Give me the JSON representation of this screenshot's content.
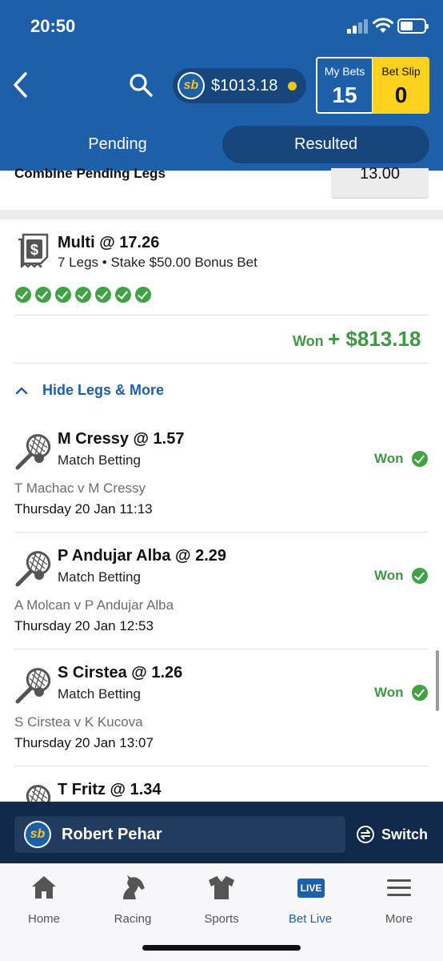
{
  "status_bar": {
    "time": "20:50",
    "battery_level": 0.55
  },
  "header": {
    "balance": "$1013.18",
    "my_bets": {
      "label": "My Bets",
      "count": "15"
    },
    "bet_slip": {
      "label": "Bet Slip",
      "count": "0"
    },
    "tabs": [
      {
        "label": "Pending",
        "active": false
      },
      {
        "label": "Resulted",
        "active": true
      }
    ],
    "colors": {
      "brand_blue": "#1d5fa8",
      "dark_blue": "#17467c",
      "yellow": "#fcd21f",
      "won_green": "#3a9a3f"
    }
  },
  "previous_bet": {
    "combine_label": "Combine Pending Legs",
    "combine_odds": "13.00"
  },
  "multi_bet": {
    "title": "Multi @ 17.26",
    "legs_count": "7 Legs",
    "stake": "Stake $50.00 Bonus Bet",
    "separator": "•",
    "legs_won": 7,
    "result_label": "Won",
    "result_amount": "+ $813.18",
    "toggle_label": "Hide Legs & More"
  },
  "legs": [
    {
      "title": "M Cressy @ 1.57",
      "market": "Match Betting",
      "status": "Won",
      "event": "T Machac v M Cressy",
      "time": "Thursday 20 Jan 11:13"
    },
    {
      "title": "P Andujar Alba @ 2.29",
      "market": "Match Betting",
      "status": "Won",
      "event": "A Molcan v P Andujar Alba",
      "time": "Thursday 20 Jan 12:53"
    },
    {
      "title": "S Cirstea @ 1.26",
      "market": "Match Betting",
      "status": "Won",
      "event": "S Cirstea v K Kucova",
      "time": "Thursday 20 Jan 13:07"
    },
    {
      "title": "T Fritz @ 1.34",
      "market": "",
      "status": "",
      "event": "",
      "time": ""
    }
  ],
  "account": {
    "name": "Robert Pehar",
    "switch_label": "Switch",
    "logo_text": "sb"
  },
  "bottom_nav": [
    {
      "label": "Home",
      "icon": "home-icon"
    },
    {
      "label": "Racing",
      "icon": "horse-icon"
    },
    {
      "label": "Sports",
      "icon": "jersey-icon"
    },
    {
      "label": "Bet Live",
      "icon": "live-icon",
      "badge": "LIVE",
      "active": true
    },
    {
      "label": "More",
      "icon": "menu-icon"
    }
  ]
}
